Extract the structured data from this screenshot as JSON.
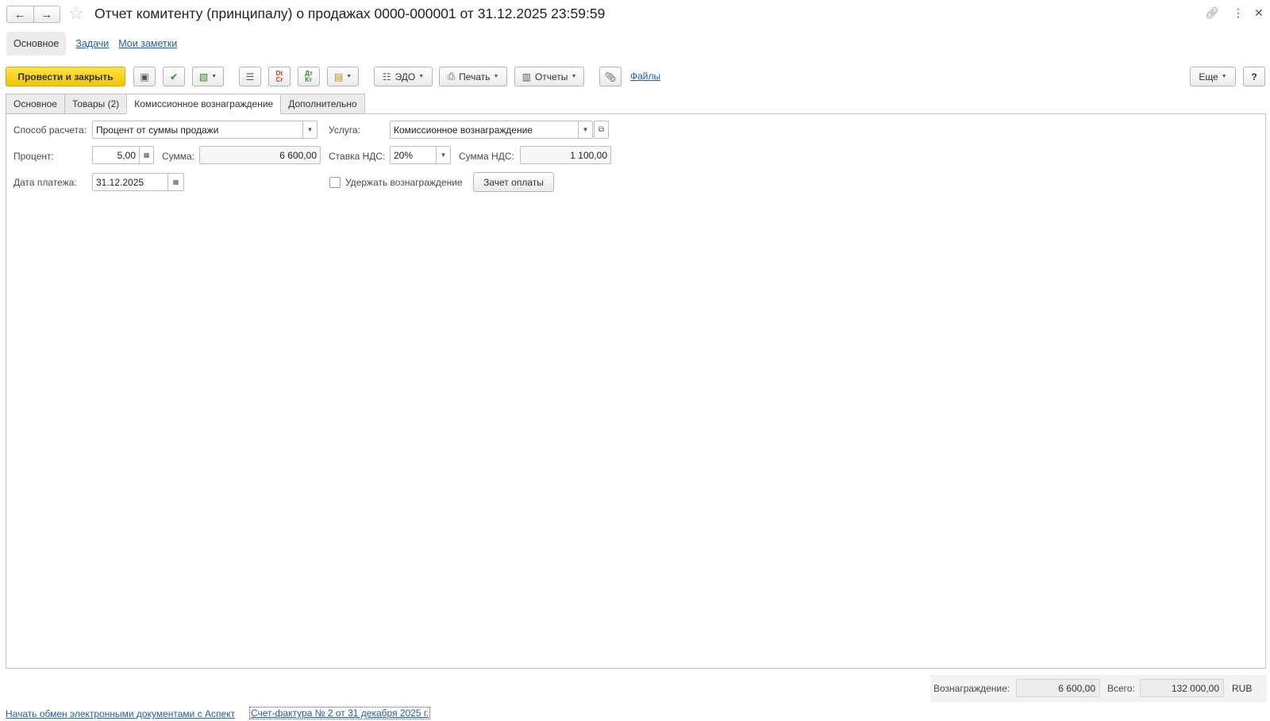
{
  "window": {
    "title": "Отчет комитенту (принципалу) о продажах 0000-000001 от 31.12.2025 23:59:59"
  },
  "sections": {
    "active": "Основное",
    "links": [
      "Задачи",
      "Мои заметки"
    ]
  },
  "toolbar": {
    "post_close": "Провести и закрыть",
    "edo": "ЭДО",
    "print": "Печать",
    "reports": "Отчеты",
    "files": "Файлы",
    "more": "Еще",
    "help": "?",
    "dtkt_1": "Dt\nCr",
    "dtkt_2": "Дт\nКт"
  },
  "tabs": [
    {
      "label": "Основное",
      "active": false
    },
    {
      "label": "Товары (2)",
      "active": false
    },
    {
      "label": "Комиссионное вознаграждение",
      "active": true
    },
    {
      "label": "Дополнительно",
      "active": false
    }
  ],
  "form": {
    "calc_method_label": "Способ расчета:",
    "calc_method_value": "Процент от суммы продажи",
    "service_label": "Услуга:",
    "service_value": "Комиссионное вознаграждение",
    "percent_label": "Процент:",
    "percent_value": "5,00",
    "sum_label": "Сумма:",
    "sum_value": "6 600,00",
    "vat_rate_label": "Ставка НДС:",
    "vat_rate_value": "20%",
    "vat_sum_label": "Сумма НДС:",
    "vat_sum_value": "1 100,00",
    "pay_date_label": "Дата платежа:",
    "pay_date_value": "31.12.2025",
    "withhold_label": "Удержать вознаграждение",
    "withhold_checked": false,
    "offset_button": "Зачет оплаты"
  },
  "footer": {
    "link_edo": "Начать обмен электронными документами с Аспект",
    "link_invoice": "Счет-фактура № 2 от 31 декабря 2025 г.",
    "reward_label": "Вознаграждение:",
    "reward_value": "6 600,00",
    "total_label": "Всего:",
    "total_value": "132 000,00",
    "currency": "RUB"
  },
  "icons": {
    "back": "arrow-left-icon",
    "forward": "arrow-right-icon",
    "star": "star-icon",
    "link": "link-icon",
    "menu": "kebab-menu-icon",
    "close": "close-icon"
  }
}
